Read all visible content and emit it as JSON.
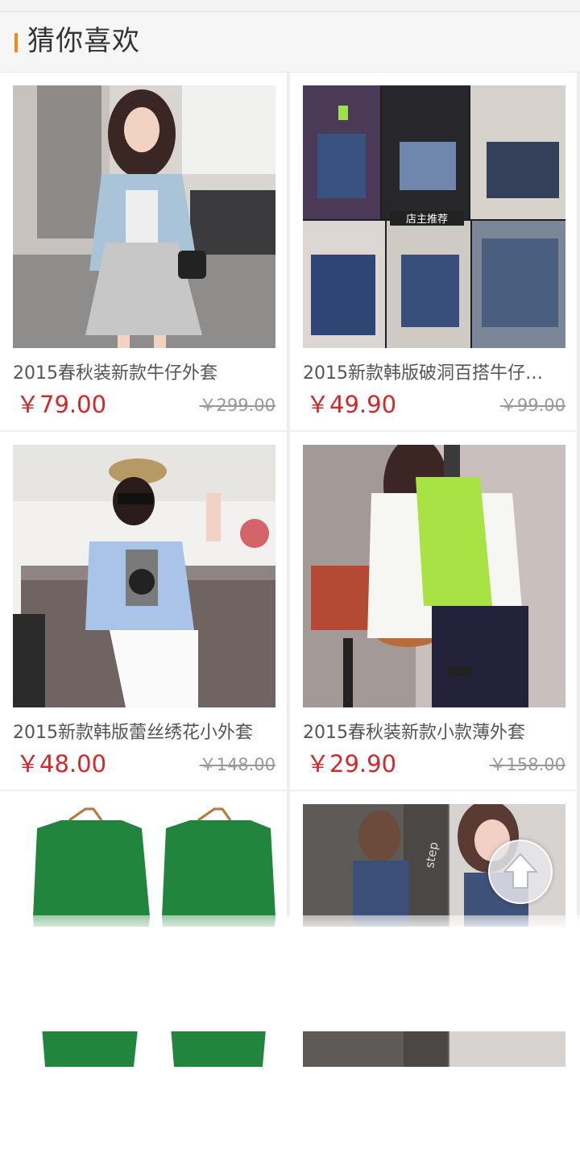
{
  "section": {
    "title": "猜你喜欢"
  },
  "products": [
    {
      "title": "2015春秋装新款牛仔外套",
      "price": "￥79.00",
      "old_price": "￥299.00"
    },
    {
      "title": "2015新款韩版破洞百搭牛仔…",
      "price": "￥49.90",
      "old_price": "￥99.00"
    },
    {
      "title": "2015新款韩版蕾丝绣花小外套",
      "price": "￥48.00",
      "old_price": "￥148.00"
    },
    {
      "title": "2015春秋装新款小款薄外套",
      "price": "￥29.90",
      "old_price": "￥158.00"
    }
  ],
  "overlay_text": {
    "shop_recommend": "店主推荐",
    "step": "step"
  },
  "icons": {
    "scroll_to_top": "arrow-up-icon"
  },
  "colors": {
    "accent": "#f08a1c",
    "price": "#d4282a",
    "old_price": "#999999"
  }
}
